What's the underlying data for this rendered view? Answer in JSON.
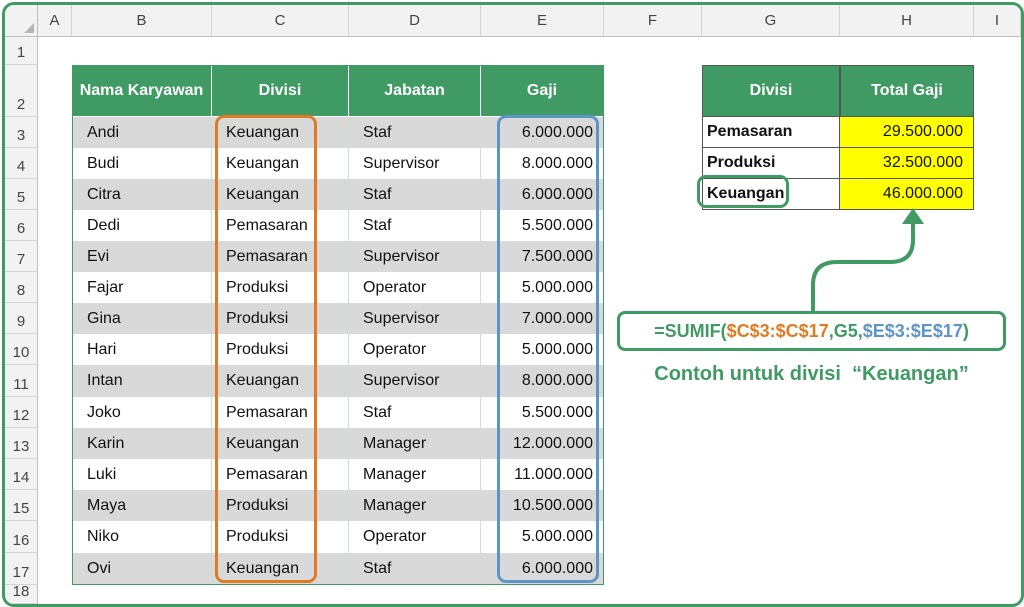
{
  "columns": [
    "A",
    "B",
    "C",
    "D",
    "E",
    "F",
    "G",
    "H",
    "I"
  ],
  "rows": [
    "1",
    "2",
    "3",
    "4",
    "5",
    "6",
    "7",
    "8",
    "9",
    "10",
    "11",
    "12",
    "13",
    "14",
    "15",
    "16",
    "17",
    "18"
  ],
  "main_table": {
    "headers": [
      "Nama Karyawan",
      "Divisi",
      "Jabatan",
      "Gaji"
    ],
    "rows": [
      [
        "Andi",
        "Keuangan",
        "Staf",
        "6.000.000"
      ],
      [
        "Budi",
        "Keuangan",
        "Supervisor",
        "8.000.000"
      ],
      [
        "Citra",
        "Keuangan",
        "Staf",
        "6.000.000"
      ],
      [
        "Dedi",
        "Pemasaran",
        "Staf",
        "5.500.000"
      ],
      [
        "Evi",
        "Pemasaran",
        "Supervisor",
        "7.500.000"
      ],
      [
        "Fajar",
        "Produksi",
        "Operator",
        "5.000.000"
      ],
      [
        "Gina",
        "Produksi",
        "Supervisor",
        "7.000.000"
      ],
      [
        "Hari",
        "Produksi",
        "Operator",
        "5.000.000"
      ],
      [
        "Intan",
        "Keuangan",
        "Supervisor",
        "8.000.000"
      ],
      [
        "Joko",
        "Pemasaran",
        "Staf",
        "5.500.000"
      ],
      [
        "Karin",
        "Keuangan",
        "Manager",
        "12.000.000"
      ],
      [
        "Luki",
        "Pemasaran",
        "Manager",
        "11.000.000"
      ],
      [
        "Maya",
        "Produksi",
        "Manager",
        "10.500.000"
      ],
      [
        "Niko",
        "Produksi",
        "Operator",
        "5.000.000"
      ],
      [
        "Ovi",
        "Keuangan",
        "Staf",
        "6.000.000"
      ]
    ],
    "header_color": "#3f9a63",
    "stripe_color": "#d9d9d9"
  },
  "summary_table": {
    "headers": [
      "Divisi",
      "Total Gaji"
    ],
    "rows": [
      [
        "Pemasaran",
        "29.500.000"
      ],
      [
        "Produksi",
        "32.500.000"
      ],
      [
        "Keuangan",
        "46.000.000"
      ]
    ],
    "value_fill": "#ffff00"
  },
  "formula": {
    "prefix": "=SUMIF(",
    "range": "$C$3:$C$17",
    "sep1": ", ",
    "criteria": "G5",
    "sep2": ", ",
    "sum_range": "$E$3:$E$17",
    "suffix": ")"
  },
  "caption": "Contoh untuk divisi  “Keuangan”",
  "colors": {
    "green": "#3f9a63",
    "orange": "#e07b24",
    "blue": "#5d95c8"
  }
}
